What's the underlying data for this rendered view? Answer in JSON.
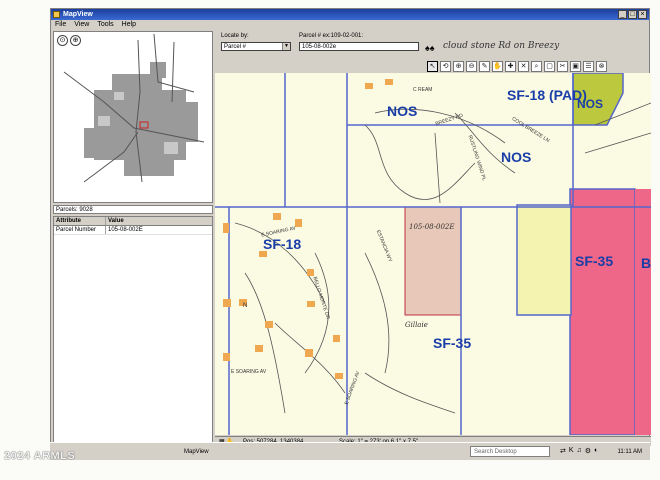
{
  "window": {
    "title": "MapView"
  },
  "menu": {
    "items": [
      "File",
      "View",
      "Tools",
      "Help"
    ]
  },
  "overview_tools": [
    "⊙",
    "⊕"
  ],
  "panel": {
    "parcels": "Parcels: 9028"
  },
  "attributes": {
    "headers": [
      "Attribute",
      "Value"
    ],
    "rows": [
      [
        "Parcel Number",
        "105-08-002E"
      ]
    ]
  },
  "locate": {
    "label": "Locate by:",
    "selected": "Parcel #",
    "example_label": "Parcel # ex:109-02-001:",
    "value": "105-08-002e",
    "handwritten_note": "cloud stone Rd on Breezy"
  },
  "map_tools": [
    "↖",
    "⟲",
    "⊕",
    "⊖",
    "✎",
    "✋",
    "✚",
    "✕",
    "⌕",
    "▢",
    "✂",
    "▣",
    "☰",
    "⊗"
  ],
  "zones": {
    "nos_top": "NOS",
    "sf18pad": "SF-18 (PAD)",
    "nos_green": "NOS",
    "nos_mid": "NOS",
    "sf18": "SF-18",
    "sf35_mid": "SF-35",
    "bg": "BG",
    "sf35_bottom": "SF-35"
  },
  "streets": {
    "cream": "C REAM",
    "breezy": "BREEZY RD",
    "cool": "COOL BREEZE LN",
    "rustling": "RUSTLING WIND PL",
    "soaring": "E SOARING AV",
    "estancia": "ESTANCIA WY",
    "bello": "BELLO MONTE DR",
    "e_soaring": "E SOARING AV",
    "soaring_s": "E SOARING AV"
  },
  "parcel_note": "105-08-002E",
  "parcel_hand": "Gillaie",
  "scale_mark": "N",
  "status": {
    "pos": "Pos: 507284, 1340384",
    "scale": "Scale:  1\" = 273' on 6.1\" x 7.5\""
  },
  "taskbar": {
    "app": "MapView",
    "search": "Search Desktop",
    "clock": "11:11 AM"
  },
  "watermark": "2024 ARMLS",
  "colors": {
    "zone_text": "#1a3ea8",
    "zone_border": "#5566cc",
    "bg_zone": "#ee6688",
    "sf35_fill": "#f4f4b0",
    "nos_fill": "#bcc93e",
    "parcel_fill": "#e8c8b8",
    "house": "#f0a850"
  }
}
